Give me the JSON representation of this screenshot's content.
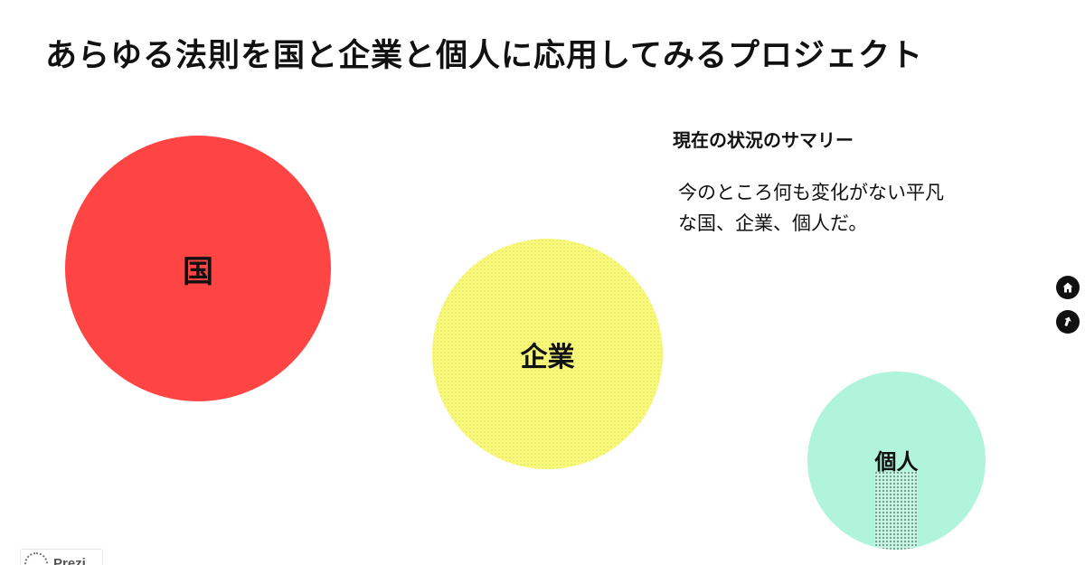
{
  "page": {
    "title": "あらゆる法則を国と企業と個人に応用してみるプロジェクト"
  },
  "summary": {
    "heading": "現在の状況のサマリー",
    "body_lines": [
      "今のところ何も変化がない平凡",
      "な国、企業、個人だ。"
    ]
  },
  "circles": [
    {
      "label": "国",
      "color": "#ff4444"
    },
    {
      "label": "企業",
      "color": "#f8f87a"
    },
    {
      "label": "個人",
      "color": "#b0f4dc"
    }
  ],
  "nav": {
    "home_icon": "home-icon",
    "back_icon": "back-arrow-icon"
  },
  "logo": {
    "text": "Prezi"
  }
}
